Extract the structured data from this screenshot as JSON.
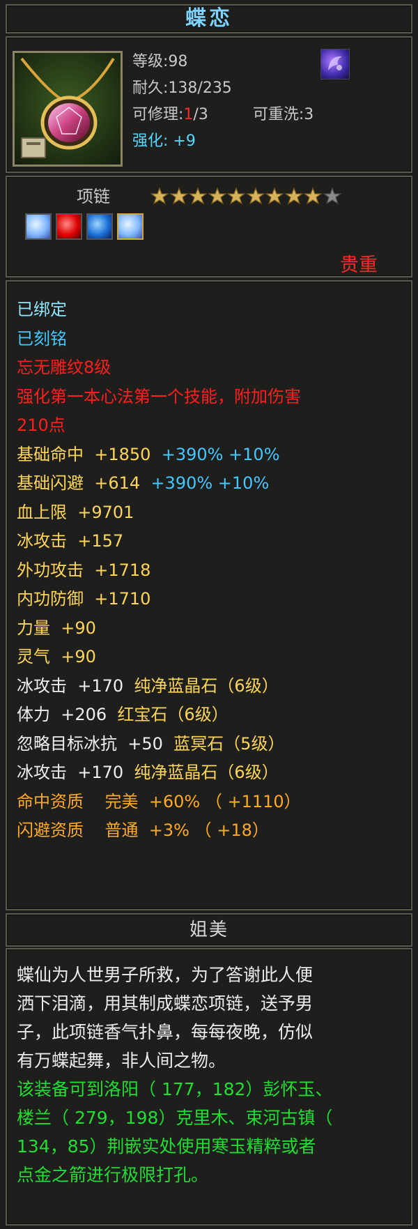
{
  "title": "蝶恋",
  "header": {
    "level": "等级:98",
    "durability": "耐久:138/235",
    "repair_label": "可修理:",
    "repair_used": "1",
    "repair_total": "/3",
    "rewash": "可重洗:3",
    "enhance": "强化: +9"
  },
  "item": {
    "type": "项链",
    "stars_filled": 9,
    "stars_total": 10,
    "rarity": "贵重"
  },
  "attributes": [
    {
      "text": "已绑定",
      "color": "c-cyan"
    },
    {
      "text": "已刻铭",
      "color": "c-blue"
    },
    {
      "text": "忘无雕纹8级",
      "color": "c-red"
    },
    {
      "text": "强化第一本心法第一个技能，附加伤害",
      "color": "c-red"
    },
    {
      "text": "210点",
      "color": "c-red"
    },
    {
      "parts": [
        {
          "text": "基础命中  +1850  ",
          "color": "c-yellow"
        },
        {
          "text": "+390% +10%",
          "color": "c-blue"
        }
      ]
    },
    {
      "parts": [
        {
          "text": "基础闪避  +614  ",
          "color": "c-yellow"
        },
        {
          "text": "+390% +10%",
          "color": "c-blue"
        }
      ]
    },
    {
      "text": "血上限  +9701",
      "color": "c-yellow"
    },
    {
      "text": "冰攻击  +157",
      "color": "c-yellow"
    },
    {
      "text": "外功攻击  +1718",
      "color": "c-yellow"
    },
    {
      "text": "内功防御  +1710",
      "color": "c-yellow"
    },
    {
      "text": "力量  +90",
      "color": "c-yellow"
    },
    {
      "text": "灵气  +90",
      "color": "c-yellow"
    },
    {
      "parts": [
        {
          "text": "冰攻击  +170  ",
          "color": "c-white"
        },
        {
          "text": "纯净蓝晶石（6级）",
          "color": "c-yellow"
        }
      ]
    },
    {
      "parts": [
        {
          "text": "体力  +206  ",
          "color": "c-white"
        },
        {
          "text": "红宝石（6级）",
          "color": "c-yellow"
        }
      ]
    },
    {
      "parts": [
        {
          "text": "忽略目标冰抗  +50  ",
          "color": "c-white"
        },
        {
          "text": "蓝冥石（5级）",
          "color": "c-yellow"
        }
      ]
    },
    {
      "parts": [
        {
          "text": "冰攻击  +170  ",
          "color": "c-white"
        },
        {
          "text": "纯净蓝晶石（6级）",
          "color": "c-yellow"
        }
      ]
    },
    {
      "text": "命中资质    完美  +60% （ +1110）",
      "color": "c-orange"
    },
    {
      "text": "闪避资质    普通  +3% （ +18）",
      "color": "c-orange"
    }
  ],
  "subtitle": "姐美",
  "description": [
    {
      "text": "蝶仙为人世男子所救，为了答谢此人便",
      "color": "white"
    },
    {
      "text": "洒下泪滴，用其制成蝶恋项链，送予男",
      "color": "white"
    },
    {
      "text": "子，此项链香气扑鼻，每每夜晚，仿似",
      "color": "white"
    },
    {
      "text": "有万蝶起舞，非人间之物。",
      "color": "white"
    },
    {
      "text": "该装备可到洛阳（ 177，182）彭怀玉、",
      "color": "green"
    },
    {
      "text": "楼兰（ 279，198）克里木、束河古镇（",
      "color": "green"
    },
    {
      "text": "134，85）荆嵌实处使用寒玉精粹或者",
      "color": "green"
    },
    {
      "text": "点金之箭进行极限打孔。",
      "color": "green"
    }
  ],
  "icons": {
    "item": "necklace-icon",
    "badge": "gem-badge-icon",
    "gems": [
      "diamond-gem-icon",
      "ruby-gem-icon",
      "sapphire-gem-icon",
      "diamond-gem-icon"
    ]
  }
}
